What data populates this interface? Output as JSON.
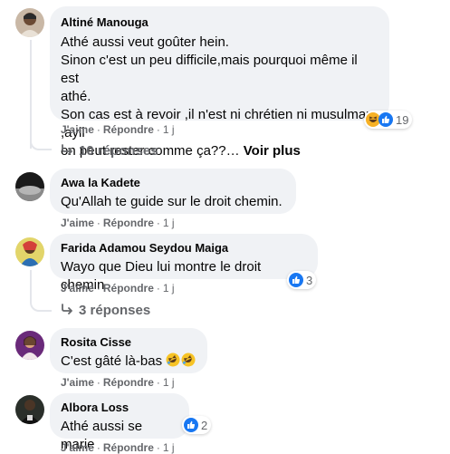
{
  "comments": [
    {
      "author": "Altiné Manouga",
      "lines": [
        "Athé aussi veut goûter hein.",
        "Sinon c'est un peu difficile,mais pourquoi même il est",
        "athé.",
        "Son cas est à revoir ,il n'est ni chrétien ni musulman ,ayii",
        "on peut rester comme ça??…"
      ],
      "see_more": "Voir plus",
      "like": "J'aime",
      "reply": "Répondre",
      "time": "1 j",
      "reactions": [
        "haha-icon",
        "like-icon"
      ],
      "reaction_count": "19",
      "replies_label": "10 réponses"
    },
    {
      "author": "Awa la Kadete",
      "text": "Qu'Allah te guide sur le droit chemin.",
      "like": "J'aime",
      "reply": "Répondre",
      "time": "1 j"
    },
    {
      "author": "Farida Adamou Seydou Maiga",
      "text": "Wayo que Dieu lui montre le droit chemin",
      "like": "J'aime",
      "reply": "Répondre",
      "time": "1 j",
      "reactions": [
        "like-icon"
      ],
      "reaction_count": "3",
      "replies_label": "3 réponses"
    },
    {
      "author": "Rosita Cisse",
      "text": "C'est gâté là-bas",
      "emojis": [
        "rolling-laughing-emoji",
        "rolling-laughing-emoji"
      ],
      "like": "J'aime",
      "reply": "Répondre",
      "time": "1 j"
    },
    {
      "author": "Albora Loss",
      "text": "Athé aussi se marie",
      "like": "J'aime",
      "reply": "Répondre",
      "time": "1 j",
      "reactions": [
        "like-icon"
      ],
      "reaction_count": "2"
    }
  ],
  "colors": {
    "bubble": "#f0f2f5",
    "meta": "#65676b",
    "like_blue": "#1877f2",
    "haha_yellow": "#f7b125"
  }
}
